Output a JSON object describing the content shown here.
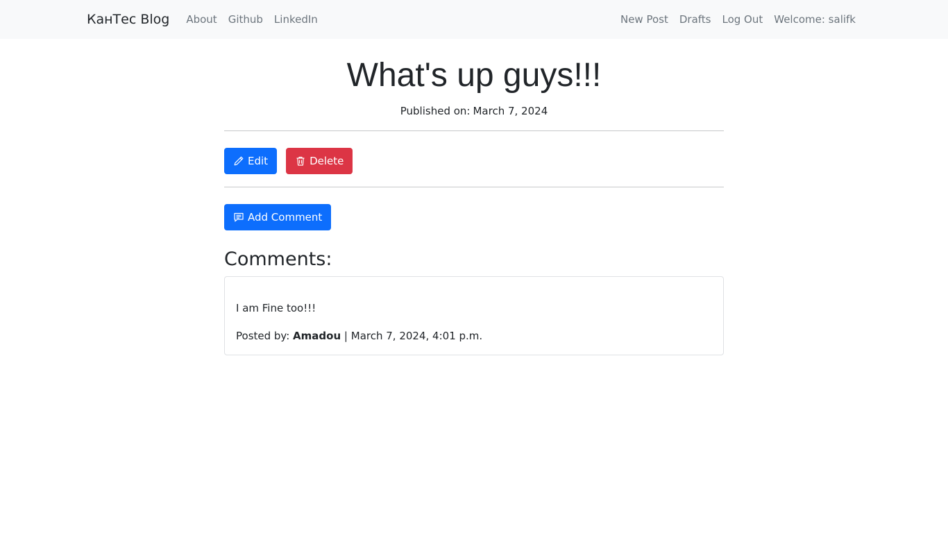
{
  "navbar": {
    "brand": "КанТес Blog",
    "left_links": [
      "About",
      "Github",
      "LinkedIn"
    ],
    "right_links": [
      "New Post",
      "Drafts",
      "Log Out"
    ],
    "welcome": "Welcome: salifk"
  },
  "post": {
    "title": "What's up guys!!!",
    "published_label": "Published on:",
    "published_date": "March 7, 2024",
    "edit_label": "Edit",
    "delete_label": "Delete",
    "add_comment_label": "Add Comment"
  },
  "comments": {
    "heading": "Comments:",
    "items": [
      {
        "body": "I am Fine too!!!",
        "posted_by_label": "Posted by:",
        "author": "Amadou",
        "separator": "|",
        "timestamp": "March 7, 2024, 4:01 p.m."
      }
    ]
  },
  "colors": {
    "primary": "#0d6efd",
    "danger": "#dc3545",
    "navbar_bg": "#f8f9fa",
    "nav_link": "#6c757d"
  },
  "icons": {
    "edit": "pencil-icon",
    "delete": "trash-icon",
    "add_comment": "chat-icon"
  }
}
